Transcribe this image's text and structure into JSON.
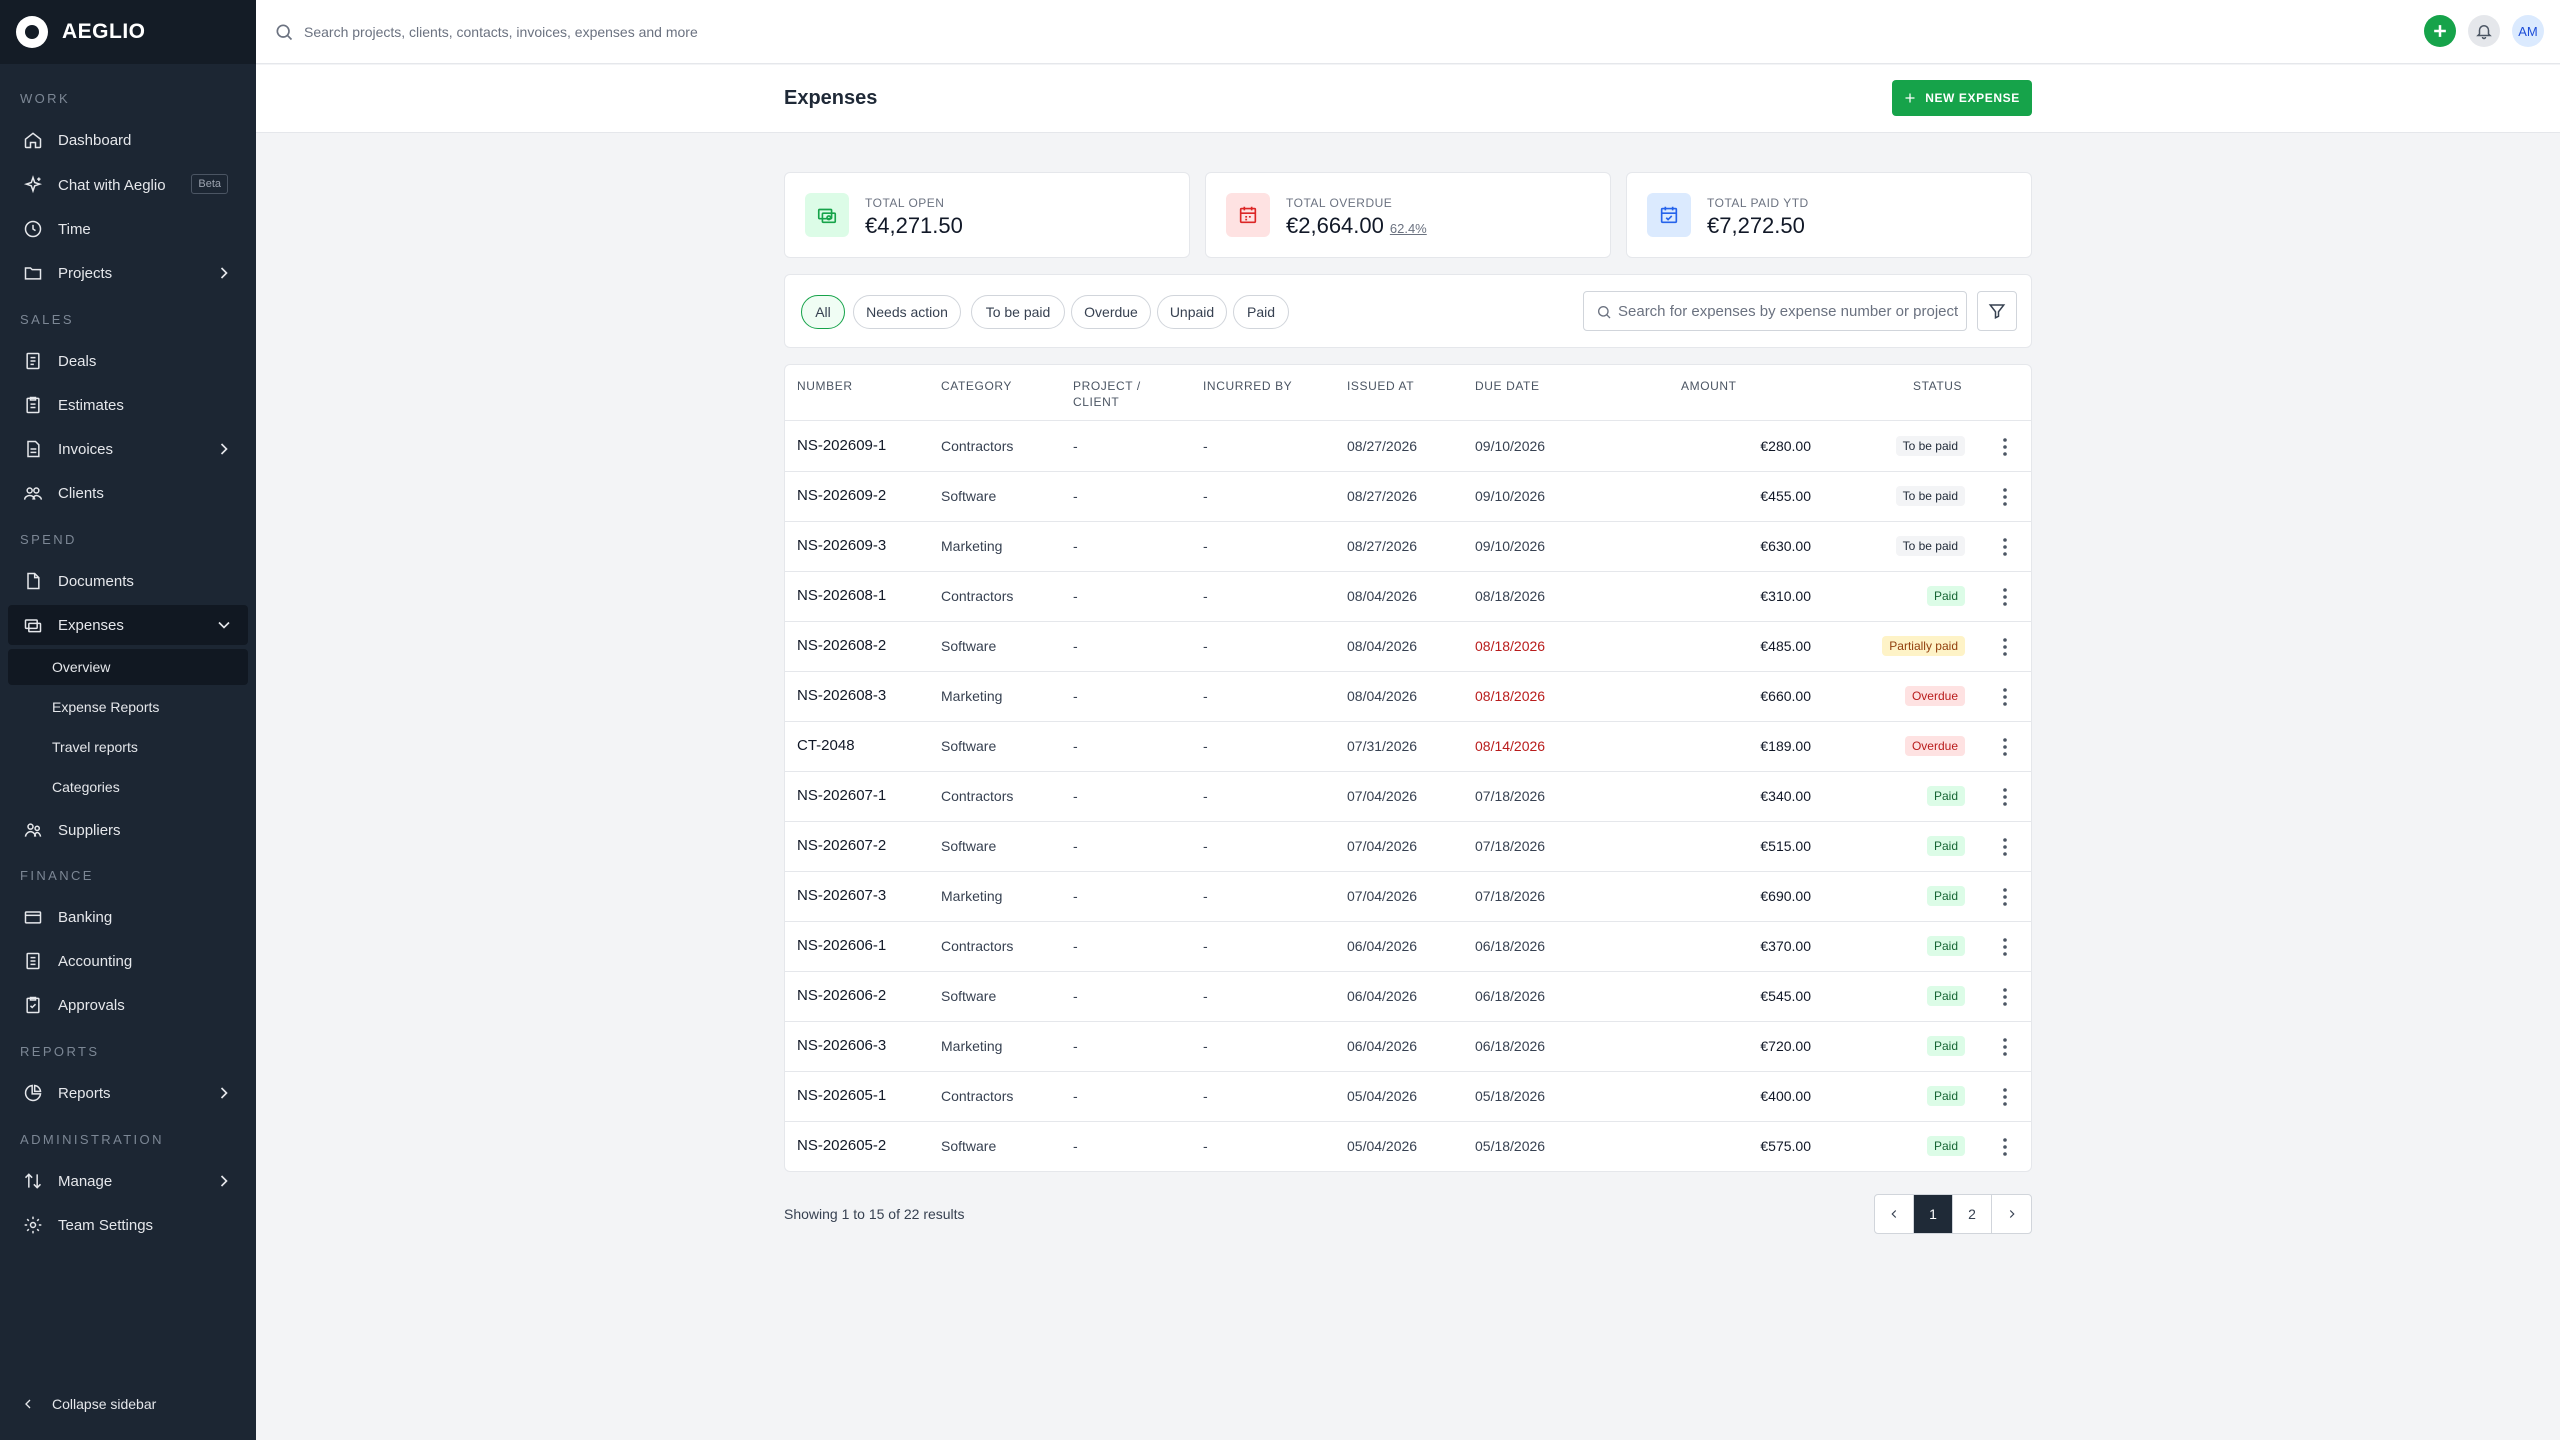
{
  "app": {
    "name": "AEGLIO"
  },
  "sidebar": {
    "sections": [
      {
        "label": "WORK"
      },
      {
        "label": "SALES"
      },
      {
        "label": "SPEND"
      },
      {
        "label": "FINANCE"
      },
      {
        "label": "REPORTS"
      },
      {
        "label": "ADMINISTRATION"
      }
    ],
    "items": [
      {
        "label": "Dashboard",
        "icon": "home-icon"
      },
      {
        "label": "Chat with Aeglio",
        "icon": "sparkle-icon",
        "badge": "Beta"
      },
      {
        "label": "Time",
        "icon": "clock-icon"
      },
      {
        "label": "Projects",
        "icon": "folder-icon"
      },
      {
        "label": "Deals",
        "icon": "deals-icon"
      },
      {
        "label": "Estimates",
        "icon": "clipboard-icon"
      },
      {
        "label": "Invoices",
        "icon": "invoice-icon"
      },
      {
        "label": "Clients",
        "icon": "users-icon"
      },
      {
        "label": "Documents",
        "icon": "document-icon"
      },
      {
        "label": "Expenses",
        "icon": "expenses-icon"
      },
      {
        "label": "Suppliers",
        "icon": "suppliers-icon"
      },
      {
        "label": "Banking",
        "icon": "card-icon"
      },
      {
        "label": "Accounting",
        "icon": "ledger-icon"
      },
      {
        "label": "Approvals",
        "icon": "check-clipboard-icon"
      },
      {
        "label": "Reports",
        "icon": "pie-chart-icon"
      },
      {
        "label": "Manage",
        "icon": "sort-icon"
      },
      {
        "label": "Team Settings",
        "icon": "gear-icon"
      }
    ],
    "expenses_sub": [
      {
        "label": "Overview"
      },
      {
        "label": "Expense Reports"
      },
      {
        "label": "Travel reports"
      },
      {
        "label": "Categories"
      }
    ],
    "collapse_label": "Collapse sidebar"
  },
  "topbar": {
    "search_placeholder": "Search projects, clients, contacts, invoices, expenses and more",
    "avatar_initials": "AM"
  },
  "page": {
    "title": "Expenses",
    "new_button": "NEW EXPENSE"
  },
  "stats": [
    {
      "label": "TOTAL OPEN",
      "value": "€4,271.50",
      "pct": "",
      "icon": "cash-icon",
      "color": "#16a34a"
    },
    {
      "label": "TOTAL OVERDUE",
      "value": "€2,664.00",
      "pct": "62.4%",
      "icon": "calendar-alert-icon",
      "color": "#dc2626"
    },
    {
      "label": "TOTAL PAID YTD",
      "value": "€7,272.50",
      "pct": "",
      "icon": "calendar-check-icon",
      "color": "#2563eb"
    }
  ],
  "filters": {
    "pills": [
      "All",
      "Needs action",
      "To be paid",
      "Overdue",
      "Unpaid",
      "Paid"
    ],
    "active": "All",
    "search_placeholder": "Search for expenses by expense number or project"
  },
  "table": {
    "headers": {
      "number": "NUMBER",
      "category": "CATEGORY",
      "project1": "PROJECT /",
      "project2": "CLIENT",
      "incurred": "INCURRED BY",
      "issued": "ISSUED AT",
      "due": "DUE DATE",
      "amount": "AMOUNT",
      "status": "STATUS"
    },
    "rows": [
      {
        "number": "NS-202609-1",
        "category": "Contractors",
        "project": "-",
        "incurred": "-",
        "issued": "08/27/2026",
        "due": "09/10/2026",
        "amount": "€280.00",
        "status": "To be paid"
      },
      {
        "number": "NS-202609-2",
        "category": "Software",
        "project": "-",
        "incurred": "-",
        "issued": "08/27/2026",
        "due": "09/10/2026",
        "amount": "€455.00",
        "status": "To be paid"
      },
      {
        "number": "NS-202609-3",
        "category": "Marketing",
        "project": "-",
        "incurred": "-",
        "issued": "08/27/2026",
        "due": "09/10/2026",
        "amount": "€630.00",
        "status": "To be paid"
      },
      {
        "number": "NS-202608-1",
        "category": "Contractors",
        "project": "-",
        "incurred": "-",
        "issued": "08/04/2026",
        "due": "08/18/2026",
        "amount": "€310.00",
        "status": "Paid"
      },
      {
        "number": "NS-202608-2",
        "category": "Software",
        "project": "-",
        "incurred": "-",
        "issued": "08/04/2026",
        "due": "08/18/2026",
        "amount": "€485.00",
        "status": "Partially paid"
      },
      {
        "number": "NS-202608-3",
        "category": "Marketing",
        "project": "-",
        "incurred": "-",
        "issued": "08/04/2026",
        "due": "08/18/2026",
        "amount": "€660.00",
        "status": "Overdue"
      },
      {
        "number": "CT-2048",
        "category": "Software",
        "project": "-",
        "incurred": "-",
        "issued": "07/31/2026",
        "due": "08/14/2026",
        "amount": "€189.00",
        "status": "Overdue"
      },
      {
        "number": "NS-202607-1",
        "category": "Contractors",
        "project": "-",
        "incurred": "-",
        "issued": "07/04/2026",
        "due": "07/18/2026",
        "amount": "€340.00",
        "status": "Paid"
      },
      {
        "number": "NS-202607-2",
        "category": "Software",
        "project": "-",
        "incurred": "-",
        "issued": "07/04/2026",
        "due": "07/18/2026",
        "amount": "€515.00",
        "status": "Paid"
      },
      {
        "number": "NS-202607-3",
        "category": "Marketing",
        "project": "-",
        "incurred": "-",
        "issued": "07/04/2026",
        "due": "07/18/2026",
        "amount": "€690.00",
        "status": "Paid"
      },
      {
        "number": "NS-202606-1",
        "category": "Contractors",
        "project": "-",
        "incurred": "-",
        "issued": "06/04/2026",
        "due": "06/18/2026",
        "amount": "€370.00",
        "status": "Paid"
      },
      {
        "number": "NS-202606-2",
        "category": "Software",
        "project": "-",
        "incurred": "-",
        "issued": "06/04/2026",
        "due": "06/18/2026",
        "amount": "€545.00",
        "status": "Paid"
      },
      {
        "number": "NS-202606-3",
        "category": "Marketing",
        "project": "-",
        "incurred": "-",
        "issued": "06/04/2026",
        "due": "06/18/2026",
        "amount": "€720.00",
        "status": "Paid"
      },
      {
        "number": "NS-202605-1",
        "category": "Contractors",
        "project": "-",
        "incurred": "-",
        "issued": "05/04/2026",
        "due": "05/18/2026",
        "amount": "€400.00",
        "status": "Paid"
      },
      {
        "number": "NS-202605-2",
        "category": "Software",
        "project": "-",
        "incurred": "-",
        "issued": "05/04/2026",
        "due": "05/18/2026",
        "amount": "€575.00",
        "status": "Paid"
      }
    ]
  },
  "pagination": {
    "showing": "Showing 1 to 15 of 22 results",
    "pages": [
      "1",
      "2"
    ],
    "current": "1"
  },
  "colors": {
    "accent": "#16a34a",
    "sidebar": "#1c2633",
    "overdue_text": "#b91c1c"
  }
}
